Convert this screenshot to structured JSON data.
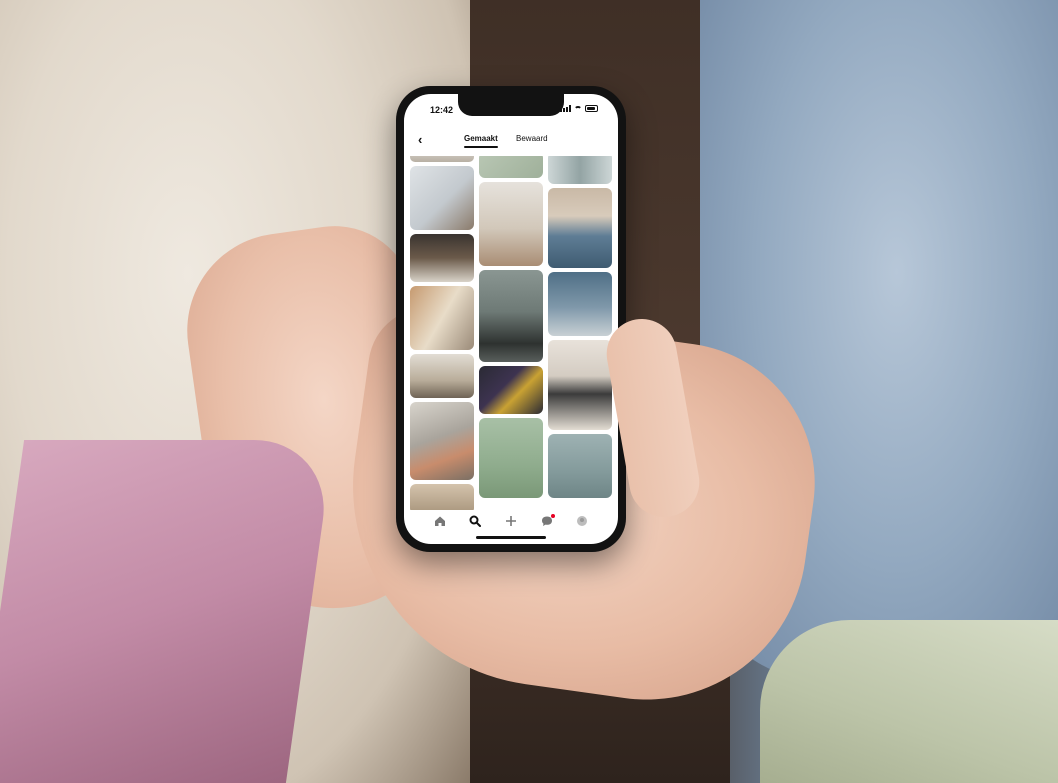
{
  "status_bar": {
    "time": "12:42"
  },
  "header": {
    "tabs": [
      {
        "label": "Gemaakt",
        "active": true
      },
      {
        "label": "Bewaard",
        "active": false
      }
    ]
  },
  "bottom_nav": {
    "items": [
      {
        "icon": "home-icon"
      },
      {
        "icon": "search-icon",
        "active": true
      },
      {
        "icon": "plus-icon"
      },
      {
        "icon": "messages-icon",
        "notification": true
      },
      {
        "icon": "profile-icon"
      }
    ]
  },
  "colors": {
    "notification": "#e60023",
    "screen_bg": "#ffffff",
    "phone_frame": "#121212"
  }
}
